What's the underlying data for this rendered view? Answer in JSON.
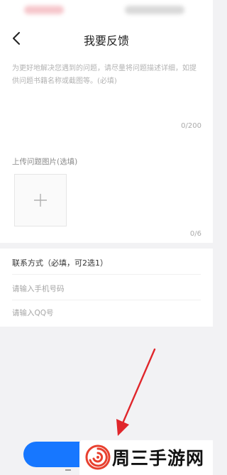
{
  "header": {
    "title": "我要反馈"
  },
  "feedback": {
    "description_placeholder": "为更好地解决您遇到的问题，请尽量将问题描述详细，如提供问题书籍名称或截图等。(必填)",
    "description_value": "",
    "char_counter": "0/200",
    "upload_label": "上传问题图片(选填)",
    "image_counter": "0/6"
  },
  "contact": {
    "label": "联系方式（必填，可2选1）",
    "phone_placeholder": "请输入手机号码",
    "qq_placeholder": "请输入QQ号"
  },
  "watermark": {
    "text": "周三手游网"
  },
  "colors": {
    "accent": "#1777ff",
    "arrow": "#e0262b",
    "logo": "#e8402f"
  },
  "icons": {
    "back": "chevron-left-icon",
    "add": "plus-icon",
    "arrow": "red-arrow-annotation",
    "logo": "swirl-logo"
  }
}
